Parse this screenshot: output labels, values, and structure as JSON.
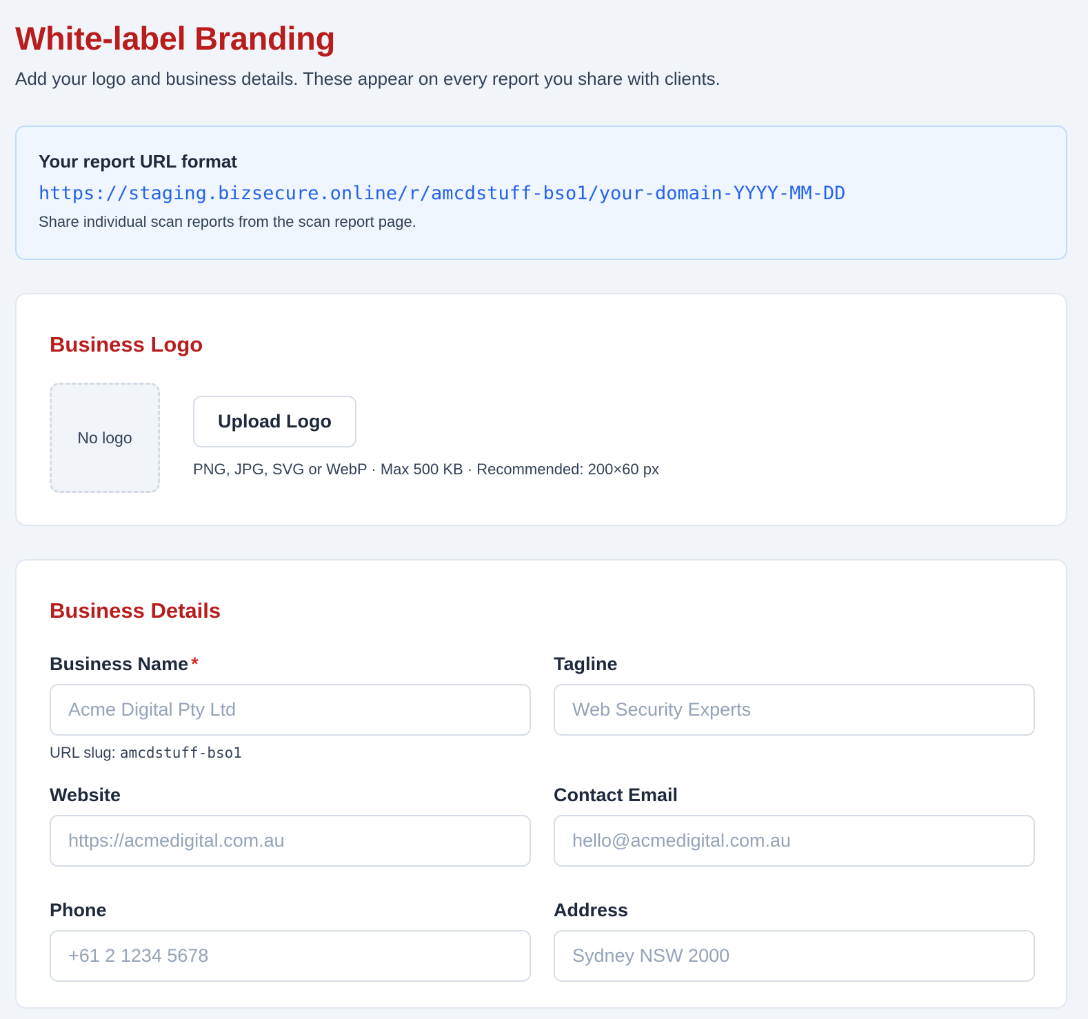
{
  "header": {
    "title": "White-label Branding",
    "subtitle": "Add your logo and business details. These appear on every report you share with clients."
  },
  "url_format": {
    "title": "Your report URL format",
    "url": "https://staging.bizsecure.online/r/amcdstuff-bso1/your-domain-YYYY-MM-DD",
    "note": "Share individual scan reports from the scan report page."
  },
  "logo_section": {
    "heading": "Business Logo",
    "placeholder_text": "No logo",
    "upload_button": "Upload Logo",
    "hint": "PNG, JPG, SVG or WebP · Max 500 KB · Recommended: 200×60 px"
  },
  "details_section": {
    "heading": "Business Details",
    "business_name": {
      "label": "Business Name",
      "required_marker": "*",
      "value": "",
      "placeholder": "Acme Digital Pty Ltd",
      "slug_label": "URL slug:",
      "slug_value": "amcdstuff-bso1"
    },
    "tagline": {
      "label": "Tagline",
      "value": "",
      "placeholder": "Web Security Experts"
    },
    "website": {
      "label": "Website",
      "value": "",
      "placeholder": "https://acmedigital.com.au"
    },
    "contact_email": {
      "label": "Contact Email",
      "value": "",
      "placeholder": "hello@acmedigital.com.au"
    },
    "phone": {
      "label": "Phone",
      "value": "",
      "placeholder": "+61 2 1234 5678"
    },
    "address": {
      "label": "Address",
      "value": "",
      "placeholder": "Sydney NSW 2000"
    }
  },
  "colors": {
    "accent_red": "#b91c1c",
    "link_blue": "#2563eb",
    "page_background": "#f1f5fa",
    "info_panel_background": "#eff6ff"
  }
}
